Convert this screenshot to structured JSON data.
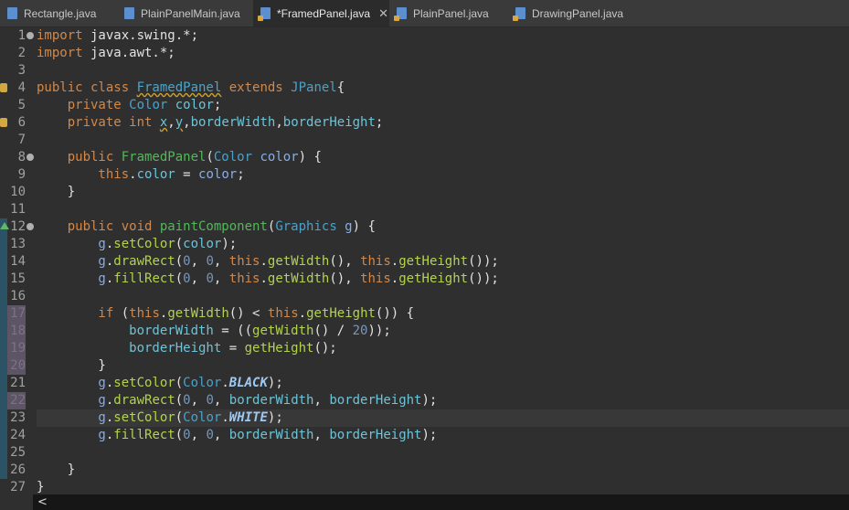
{
  "tabs": [
    {
      "label": "Rectangle.java",
      "active": false,
      "lock": false
    },
    {
      "label": "PlainPanelMain.java",
      "active": false,
      "lock": false
    },
    {
      "label": "*FramedPanel.java",
      "active": true,
      "lock": true
    },
    {
      "label": "PlainPanel.java",
      "active": false,
      "lock": true
    },
    {
      "label": "DrawingPanel.java",
      "active": false,
      "lock": true
    }
  ],
  "close_glyph": "✕",
  "scroll_left_glyph": "<",
  "lines": [
    {
      "n": "1",
      "tokens": [
        [
          "k",
          "import"
        ],
        [
          "p",
          " javax.swing.*;"
        ]
      ]
    },
    {
      "n": "2",
      "tokens": [
        [
          "k",
          "import"
        ],
        [
          "p",
          " java.awt.*;"
        ]
      ]
    },
    {
      "n": "3",
      "tokens": []
    },
    {
      "n": "4",
      "tokens": [
        [
          "k",
          "public class "
        ],
        [
          "d",
          "FramedPanel"
        ],
        [
          "k",
          " extends "
        ],
        [
          "t",
          "JPanel"
        ],
        [
          "p",
          "{"
        ]
      ]
    },
    {
      "n": "5",
      "tokens": [
        [
          "k",
          "    private "
        ],
        [
          "t",
          "Color "
        ],
        [
          "f",
          "color"
        ],
        [
          "p",
          ";"
        ]
      ]
    },
    {
      "n": "6",
      "tokens": [
        [
          "k",
          "    private int "
        ],
        [
          "u",
          "x"
        ],
        [
          "p",
          ","
        ],
        [
          "u",
          "y"
        ],
        [
          "p",
          ","
        ],
        [
          "f",
          "borderWidth"
        ],
        [
          "p",
          ","
        ],
        [
          "f",
          "borderHeight"
        ],
        [
          "p",
          ";"
        ]
      ]
    },
    {
      "n": "7",
      "tokens": []
    },
    {
      "n": "8",
      "tokens": [
        [
          "k",
          "    public "
        ],
        [
          "g",
          "FramedPanel"
        ],
        [
          "p",
          "("
        ],
        [
          "t",
          "Color "
        ],
        [
          "v",
          "color"
        ],
        [
          "p",
          ") {"
        ]
      ]
    },
    {
      "n": "9",
      "tokens": [
        [
          "k",
          "        this"
        ],
        [
          "p",
          "."
        ],
        [
          "f",
          "color"
        ],
        [
          "p",
          " = "
        ],
        [
          "v",
          "color"
        ],
        [
          "p",
          ";"
        ]
      ]
    },
    {
      "n": "10",
      "tokens": [
        [
          "p",
          "    }"
        ]
      ]
    },
    {
      "n": "11",
      "tokens": []
    },
    {
      "n": "12",
      "tokens": [
        [
          "k",
          "    public void "
        ],
        [
          "g",
          "paintComponent"
        ],
        [
          "p",
          "("
        ],
        [
          "t",
          "Graphics "
        ],
        [
          "v",
          "g"
        ],
        [
          "p",
          ") {"
        ]
      ]
    },
    {
      "n": "13",
      "tokens": [
        [
          "v",
          "        g"
        ],
        [
          "p",
          "."
        ],
        [
          "m",
          "setColor"
        ],
        [
          "p",
          "("
        ],
        [
          "f",
          "color"
        ],
        [
          "p",
          ");"
        ]
      ]
    },
    {
      "n": "14",
      "tokens": [
        [
          "v",
          "        g"
        ],
        [
          "p",
          "."
        ],
        [
          "m",
          "drawRect"
        ],
        [
          "p",
          "("
        ],
        [
          "n",
          "0"
        ],
        [
          "p",
          ", "
        ],
        [
          "n",
          "0"
        ],
        [
          "p",
          ", "
        ],
        [
          "k",
          "this"
        ],
        [
          "p",
          "."
        ],
        [
          "m",
          "getWidth"
        ],
        [
          "p",
          "(), "
        ],
        [
          "k",
          "this"
        ],
        [
          "p",
          "."
        ],
        [
          "m",
          "getHeight"
        ],
        [
          "p",
          "());"
        ]
      ]
    },
    {
      "n": "15",
      "tokens": [
        [
          "v",
          "        g"
        ],
        [
          "p",
          "."
        ],
        [
          "m",
          "fillRect"
        ],
        [
          "p",
          "("
        ],
        [
          "n",
          "0"
        ],
        [
          "p",
          ", "
        ],
        [
          "n",
          "0"
        ],
        [
          "p",
          ", "
        ],
        [
          "k",
          "this"
        ],
        [
          "p",
          "."
        ],
        [
          "m",
          "getWidth"
        ],
        [
          "p",
          "(), "
        ],
        [
          "k",
          "this"
        ],
        [
          "p",
          "."
        ],
        [
          "m",
          "getHeight"
        ],
        [
          "p",
          "());"
        ]
      ]
    },
    {
      "n": "16",
      "tokens": []
    },
    {
      "n": "17",
      "tokens": [
        [
          "k",
          "        if "
        ],
        [
          "p",
          "("
        ],
        [
          "k",
          "this"
        ],
        [
          "p",
          "."
        ],
        [
          "m",
          "getWidth"
        ],
        [
          "p",
          "() < "
        ],
        [
          "k",
          "this"
        ],
        [
          "p",
          "."
        ],
        [
          "m",
          "getHeight"
        ],
        [
          "p",
          "()) {"
        ]
      ]
    },
    {
      "n": "18",
      "tokens": [
        [
          "f",
          "            borderWidth"
        ],
        [
          "p",
          " = (("
        ],
        [
          "m",
          "getWidth"
        ],
        [
          "p",
          "() / "
        ],
        [
          "n",
          "20"
        ],
        [
          "p",
          "));"
        ]
      ]
    },
    {
      "n": "19",
      "tokens": [
        [
          "f",
          "            borderHeight"
        ],
        [
          "p",
          " = "
        ],
        [
          "m",
          "getHeight"
        ],
        [
          "p",
          "();"
        ]
      ]
    },
    {
      "n": "20",
      "tokens": [
        [
          "p",
          "        }"
        ]
      ]
    },
    {
      "n": "21",
      "tokens": [
        [
          "v",
          "        g"
        ],
        [
          "p",
          "."
        ],
        [
          "m",
          "setColor"
        ],
        [
          "p",
          "("
        ],
        [
          "t",
          "Color"
        ],
        [
          "p",
          "."
        ],
        [
          "c",
          "BLACK"
        ],
        [
          "p",
          ");"
        ]
      ]
    },
    {
      "n": "22",
      "tokens": [
        [
          "v",
          "        g"
        ],
        [
          "p",
          "."
        ],
        [
          "m",
          "drawRect"
        ],
        [
          "p",
          "("
        ],
        [
          "n",
          "0"
        ],
        [
          "p",
          ", "
        ],
        [
          "n",
          "0"
        ],
        [
          "p",
          ", "
        ],
        [
          "f",
          "borderWidth"
        ],
        [
          "p",
          ", "
        ],
        [
          "f",
          "borderHeight"
        ],
        [
          "p",
          ");"
        ]
      ]
    },
    {
      "n": "23",
      "tokens": [
        [
          "v",
          "        g"
        ],
        [
          "p",
          "."
        ],
        [
          "m",
          "setColor"
        ],
        [
          "p",
          "("
        ],
        [
          "t",
          "Color"
        ],
        [
          "p",
          "."
        ],
        [
          "c",
          "WHITE"
        ],
        [
          "p",
          ");"
        ]
      ]
    },
    {
      "n": "24",
      "tokens": [
        [
          "v",
          "        g"
        ],
        [
          "p",
          "."
        ],
        [
          "m",
          "fillRect"
        ],
        [
          "p",
          "("
        ],
        [
          "n",
          "0"
        ],
        [
          "p",
          ", "
        ],
        [
          "n",
          "0"
        ],
        [
          "p",
          ", "
        ],
        [
          "f",
          "borderWidth"
        ],
        [
          "p",
          ", "
        ],
        [
          "f",
          "borderHeight"
        ],
        [
          "p",
          ");"
        ]
      ]
    },
    {
      "n": "25",
      "tokens": []
    },
    {
      "n": "26",
      "tokens": [
        [
          "p",
          "    }"
        ]
      ]
    },
    {
      "n": "27",
      "tokens": [
        [
          "p",
          "}"
        ]
      ]
    }
  ]
}
